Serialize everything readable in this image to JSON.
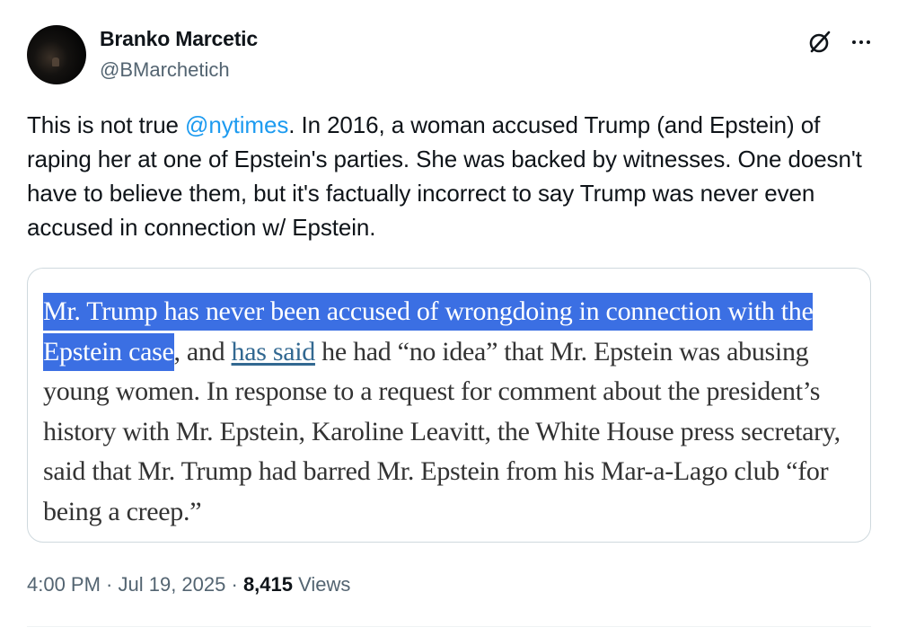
{
  "author": {
    "display_name": "Branko Marcetic",
    "handle": "@BMarchetich"
  },
  "tweet": {
    "text_before": "This is not true ",
    "mention": "@nytimes",
    "text_after": ". In 2016, a woman accused Trump (and Epstein) of raping her at one of Epstein's parties. She was backed by witnesses. One doesn't have to believe them, but it's factually incorrect to say Trump was never even accused in connection w/ Epstein."
  },
  "quote": {
    "highlighted": "Mr. Trump has never been accused of wrongdoing in connection with the Epstein case",
    "text_mid": ", and ",
    "link": "has said",
    "text_after": " he had “no idea” that Mr. Epstein was abusing young women. In response to a request for comment about the president’s history with Mr. Epstein, Karoline Leavitt, the White House press secretary, said that Mr. Trump had barred Mr. Epstein from his Mar-a-Lago club “for being a creep.”"
  },
  "meta": {
    "time": "4:00 PM",
    "sep1": " · ",
    "date": "Jul 19, 2025",
    "sep2": " · ",
    "views_count": "8,415",
    "views_label": " Views"
  },
  "icons": {
    "grok": "grok-icon",
    "more": "more-icon"
  },
  "colors": {
    "mention": "#1d9bf0",
    "highlight": "#3b6fe3",
    "nyt_link": "#326891",
    "secondary_text": "#536471"
  }
}
